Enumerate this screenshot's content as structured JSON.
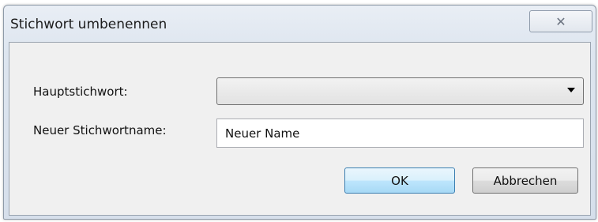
{
  "window": {
    "title": "Stichwort umbenennen",
    "close_glyph": "✕"
  },
  "form": {
    "main_keyword_label": "Hauptstichwort:",
    "main_keyword_value": "",
    "new_name_label": "Neuer Stichwortname:",
    "new_name_value": "Neuer Name"
  },
  "buttons": {
    "ok_label": "OK",
    "cancel_label": "Abbrechen"
  },
  "icons": {
    "close": "close-icon",
    "dropdown": "chevron-down-icon"
  }
}
